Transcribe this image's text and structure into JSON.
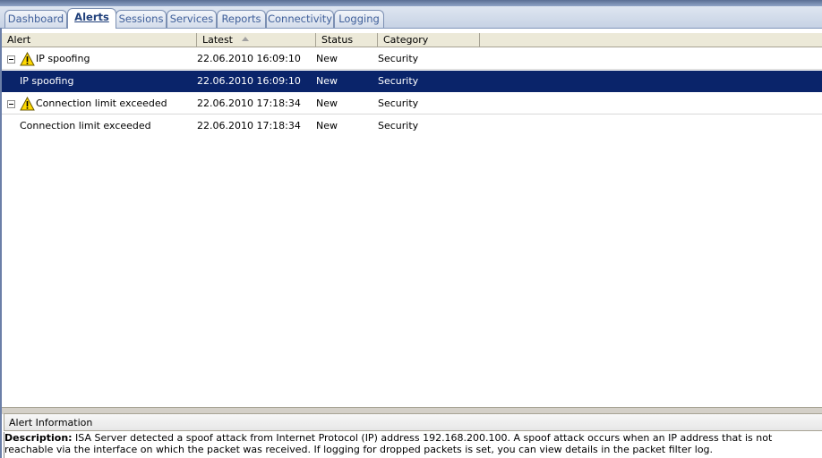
{
  "tabs": [
    {
      "label": "Dashboard",
      "active": false
    },
    {
      "label": "Alerts",
      "active": true
    },
    {
      "label": "Sessions",
      "active": false
    },
    {
      "label": "Services",
      "active": false
    },
    {
      "label": "Reports",
      "active": false
    },
    {
      "label": "Connectivity",
      "active": false
    },
    {
      "label": "Logging",
      "active": false
    }
  ],
  "table": {
    "columns": [
      "Alert",
      "Latest",
      "Status",
      "Category"
    ],
    "sorted_column": "Latest",
    "rows": [
      {
        "alert": "IP spoofing",
        "latest": "22.06.2010 16:09:10",
        "status": "New",
        "category": "Security",
        "group": true,
        "icon": "warning-icon"
      },
      {
        "alert": "IP spoofing",
        "latest": "22.06.2010 16:09:10",
        "status": "New",
        "category": "Security",
        "group": false,
        "selected": true
      },
      {
        "alert": "Connection limit exceeded",
        "latest": "22.06.2010 17:18:34",
        "status": "New",
        "category": "Security",
        "group": true,
        "icon": "warning-icon"
      },
      {
        "alert": "Connection limit exceeded",
        "latest": "22.06.2010 17:18:34",
        "status": "New",
        "category": "Security",
        "group": false
      }
    ]
  },
  "info_panel": {
    "title": "Alert Information",
    "description_label": "Description:",
    "description_text": " ISA Server detected a spoof attack from Internet Protocol (IP) address 192.168.200.100. A spoof attack occurs when an IP address that is not reachable via the interface on which the packet was received. If logging for dropped packets is set, you can view details in the packet filter log."
  },
  "colors": {
    "selection": "#0a246a",
    "tab_text": "#3f5f9a",
    "header_bg": "#ece9d8"
  }
}
